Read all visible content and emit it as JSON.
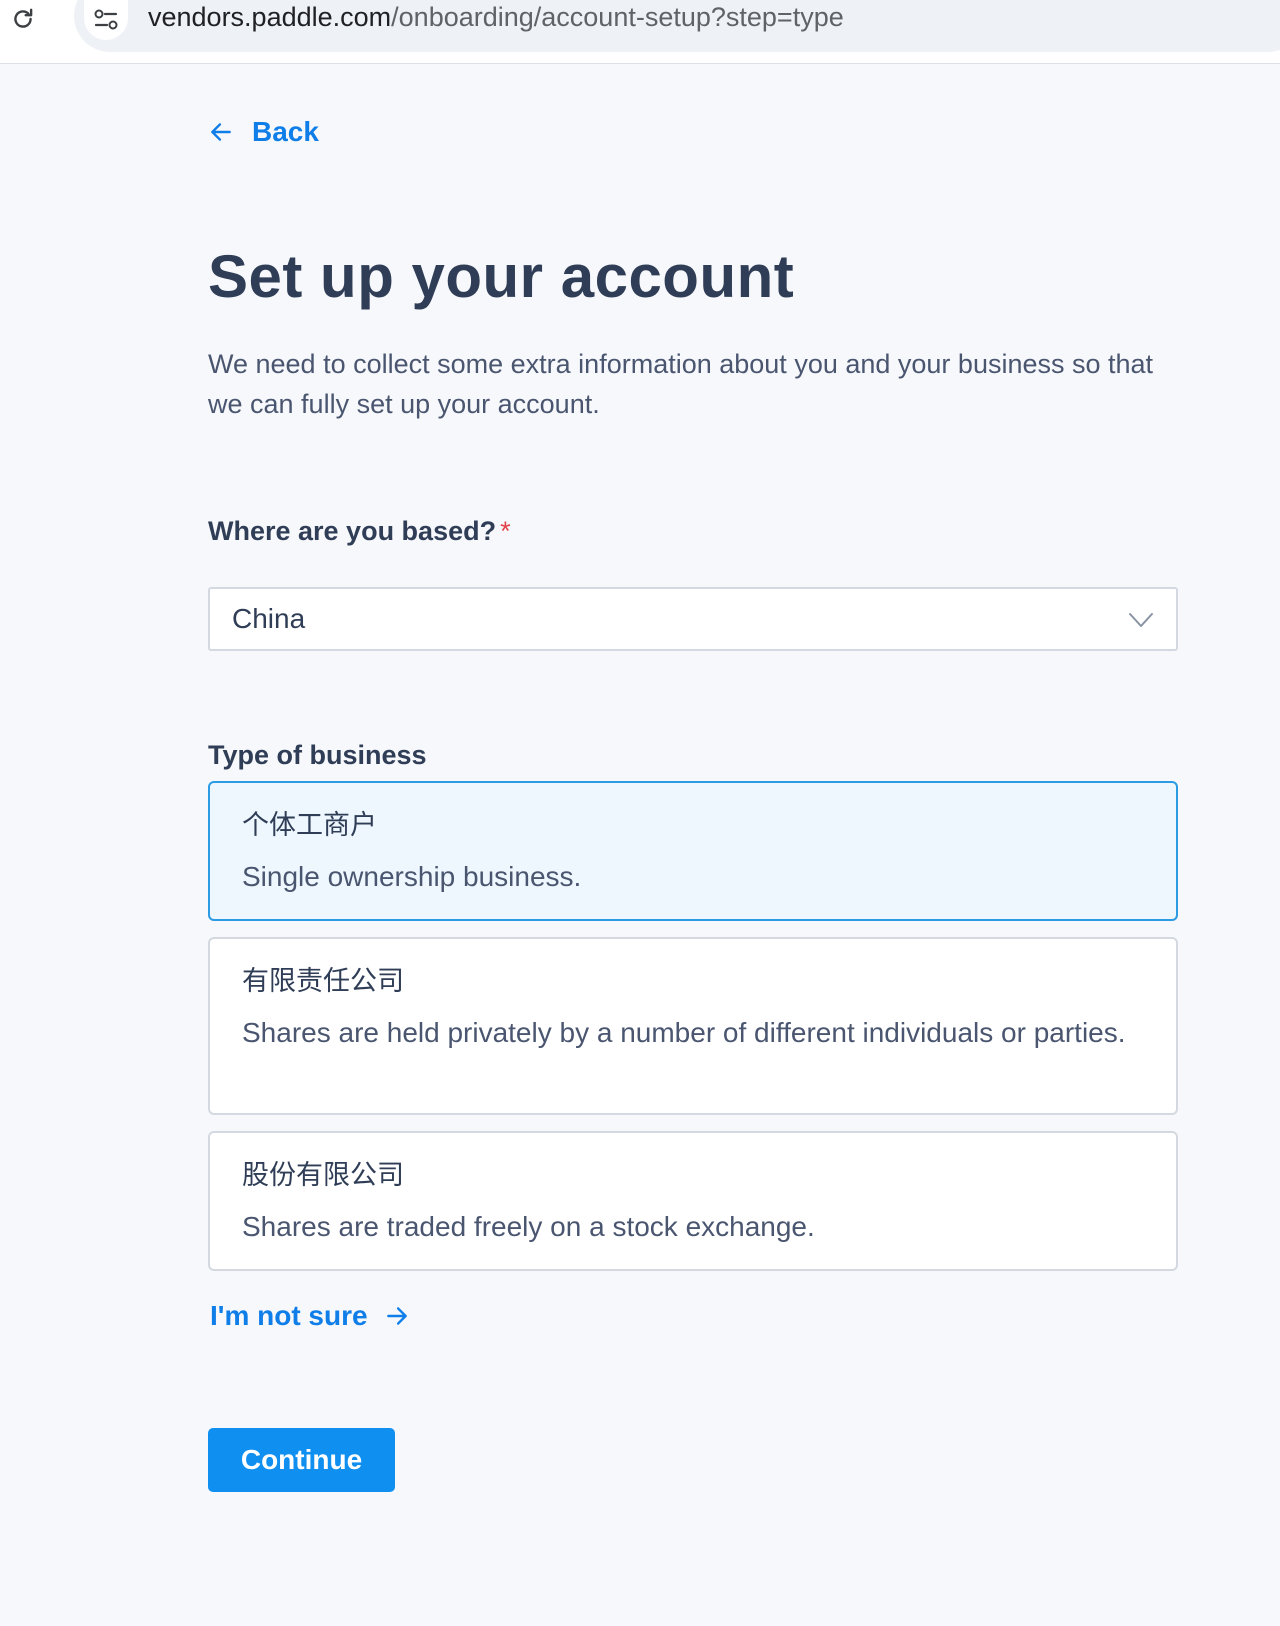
{
  "browser": {
    "url_host": "vendors.paddle.com",
    "url_path": "/onboarding/account-setup?step=type",
    "icons": {
      "reload": "reload-icon",
      "site_info": "site-info-icon"
    }
  },
  "page": {
    "back_label": "Back",
    "title": "Set up your account",
    "intro": "We need to collect some extra information about you and your business so that we can fully set up your account."
  },
  "location": {
    "label": "Where are you based?",
    "required_marker": "*",
    "selected_value": "China"
  },
  "business_type": {
    "label": "Type of business",
    "options": [
      {
        "title": "个体工商户",
        "description": "Single ownership business.",
        "selected": true
      },
      {
        "title": "有限责任公司",
        "description": "Shares are held privately by a number of different individuals or parties.",
        "selected": false
      },
      {
        "title": "股份有限公司",
        "description": "Shares are traded freely on a stock exchange.",
        "selected": false
      }
    ]
  },
  "not_sure_label": "I'm not sure",
  "continue_label": "Continue",
  "colors": {
    "accent": "#0f7ee8",
    "button": "#0f8ff0",
    "selected_border": "#2b9be3",
    "selected_bg": "#eef7fd",
    "required": "#e2424b"
  }
}
